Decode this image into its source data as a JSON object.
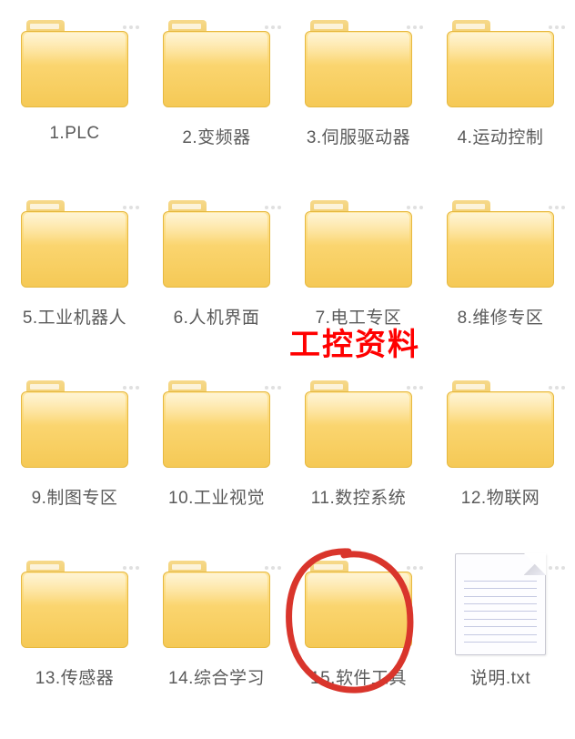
{
  "items": [
    {
      "type": "folder",
      "label": "1.PLC"
    },
    {
      "type": "folder",
      "label": "2.变频器"
    },
    {
      "type": "folder",
      "label": "3.伺服驱动器"
    },
    {
      "type": "folder",
      "label": "4.运动控制"
    },
    {
      "type": "folder",
      "label": "5.工业机器人"
    },
    {
      "type": "folder",
      "label": "6.人机界面"
    },
    {
      "type": "folder",
      "label": "7.电工专区"
    },
    {
      "type": "folder",
      "label": "8.维修专区"
    },
    {
      "type": "folder",
      "label": "9.制图专区"
    },
    {
      "type": "folder",
      "label": "10.工业视觉"
    },
    {
      "type": "folder",
      "label": "11.数控系统"
    },
    {
      "type": "folder",
      "label": "12.物联网"
    },
    {
      "type": "folder",
      "label": "13.传感器"
    },
    {
      "type": "folder",
      "label": "14.综合学习"
    },
    {
      "type": "folder",
      "label": "15.软件工具"
    },
    {
      "type": "txt",
      "label": "说明.txt"
    }
  ],
  "annotation": {
    "text": "工控资料"
  }
}
